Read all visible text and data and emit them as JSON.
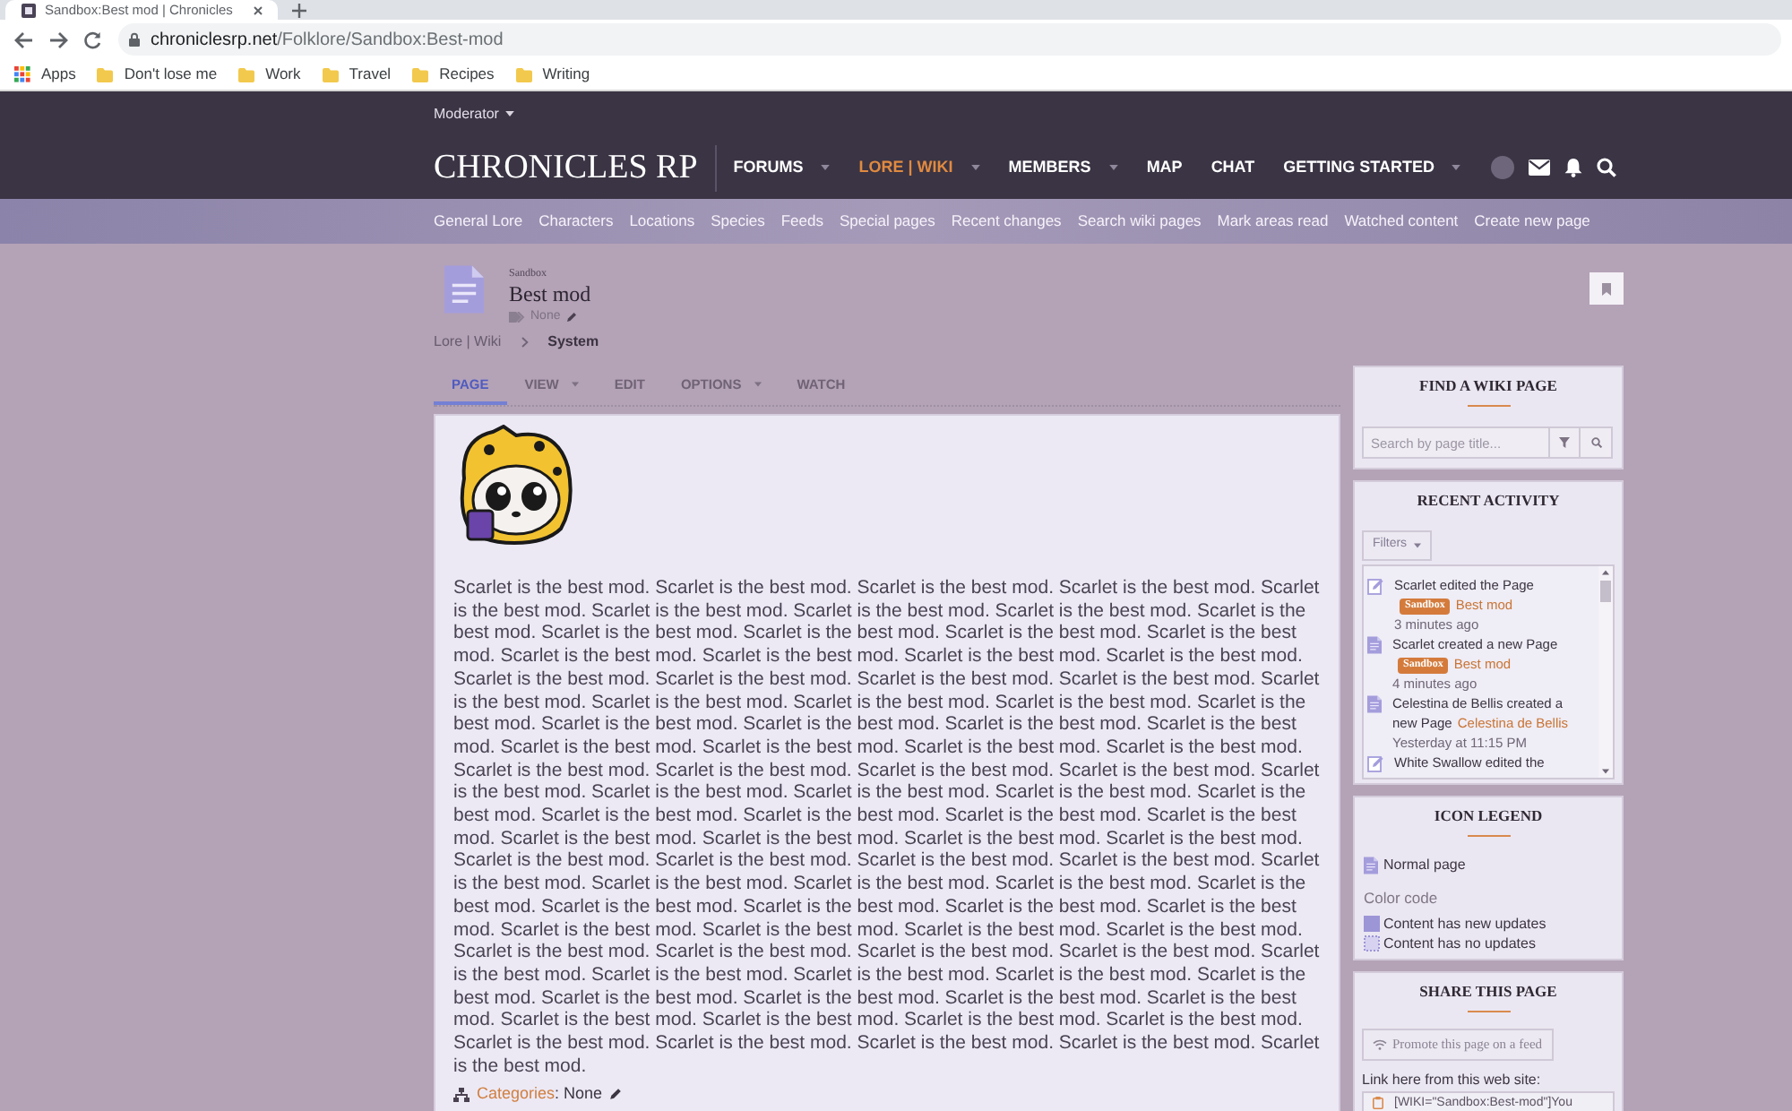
{
  "browser": {
    "tab_title": "Sandbox:Best mod | Chronicles",
    "url_domain": "chroniclesrp.net",
    "url_path": "/Folklore/Sandbox:Best-mod",
    "bookmarks": [
      {
        "kind": "apps",
        "label": "Apps"
      },
      {
        "kind": "folder",
        "label": "Don't lose me"
      },
      {
        "kind": "folder",
        "label": "Work"
      },
      {
        "kind": "folder",
        "label": "Travel"
      },
      {
        "kind": "folder",
        "label": "Recipes"
      },
      {
        "kind": "folder",
        "label": "Writing"
      }
    ]
  },
  "header": {
    "user_menu": {
      "label": "Moderator",
      "has_menu": true
    },
    "logo": "CHRONICLES RP",
    "nav": [
      {
        "label": "FORUMS",
        "selected": false,
        "has_menu": true
      },
      {
        "label": "LORE | WIKI",
        "selected": true,
        "has_menu": true
      },
      {
        "label": "MEMBERS",
        "selected": false,
        "has_menu": true
      },
      {
        "label": "MAP",
        "selected": false,
        "has_menu": false
      },
      {
        "label": "CHAT",
        "selected": false,
        "has_menu": false
      },
      {
        "label": "GETTING STARTED",
        "selected": false,
        "has_menu": true
      }
    ]
  },
  "subnav": [
    "General Lore",
    "Characters",
    "Locations",
    "Species",
    "Feeds",
    "Special pages",
    "Recent changes",
    "Search wiki pages",
    "Mark areas read",
    "Watched content",
    "Create new page"
  ],
  "page": {
    "namespace": "Sandbox",
    "title": "Best mod",
    "tags": "None",
    "breadcrumb": [
      {
        "label": "Lore | Wiki",
        "current": false
      },
      {
        "label": "System",
        "current": true
      }
    ],
    "tabs": [
      {
        "label": "PAGE",
        "selected": true,
        "has_menu": false
      },
      {
        "label": "VIEW",
        "selected": false,
        "has_menu": true
      },
      {
        "label": "EDIT",
        "selected": false,
        "has_menu": false
      },
      {
        "label": "OPTIONS",
        "selected": false,
        "has_menu": true
      },
      {
        "label": "WATCH",
        "selected": false,
        "has_menu": false
      }
    ],
    "body": "Scarlet is the best mod. Scarlet is the best mod. Scarlet is the best mod. Scarlet is the best mod. Scarlet is the best mod. Scarlet is the best mod. Scarlet is the best mod. Scarlet is the best mod. Scarlet is the best mod. Scarlet is the best mod. Scarlet is the best mod. Scarlet is the best mod. Scarlet is the best mod. Scarlet is the best mod. Scarlet is the best mod. Scarlet is the best mod. Scarlet is the best mod. Scarlet is the best mod. Scarlet is the best mod. Scarlet is the best mod. Scarlet is the best mod. Scarlet is the best mod. Scarlet is the best mod. Scarlet is the best mod. Scarlet is the best mod. Scarlet is the best mod. Scarlet is the best mod. Scarlet is the best mod. Scarlet is the best mod. Scarlet is the best mod. Scarlet is the best mod. Scarlet is the best mod. Scarlet is the best mod. Scarlet is the best mod. Scarlet is the best mod. Scarlet is the best mod. Scarlet is the best mod. Scarlet is the best mod. Scarlet is the best mod. Scarlet is the best mod. Scarlet is the best mod. Scarlet is the best mod. Scarlet is the best mod. Scarlet is the best mod. Scarlet is the best mod. Scarlet is the best mod. Scarlet is the best mod. Scarlet is the best mod. Scarlet is the best mod. Scarlet is the best mod. Scarlet is the best mod. Scarlet is the best mod. Scarlet is the best mod. Scarlet is the best mod. Scarlet is the best mod. Scarlet is the best mod. Scarlet is the best mod. Scarlet is the best mod. Scarlet is the best mod. Scarlet is the best mod. Scarlet is the best mod. Scarlet is the best mod. Scarlet is the best mod. Scarlet is the best mod. Scarlet is the best mod. Scarlet is the best mod. Scarlet is the best mod. Scarlet is the best mod. Scarlet is the best mod. Scarlet is the best mod. Scarlet is the best mod. Scarlet is the best mod. Scarlet is the best mod. Scarlet is the best mod. Scarlet is the best mod. Scarlet is the best mod. Scarlet is the best mod. Scarlet is the best mod. Scarlet is the best mod. Scarlet is the best mod. Scarlet is the best mod. Scarlet is the best mod. Scarlet is the best mod. Scarlet is the best mod. Scarlet is the best mod. Scarlet is the best mod. Scarlet is the best mod. Scarlet is the best mod. Scarlet is the best mod. Scarlet is the best mod.",
    "categories": {
      "label": "Categories",
      "value": ": None"
    }
  },
  "sidebar": [
    {
      "kind": "search",
      "title": "FIND A WIKI PAGE",
      "title_rule": true,
      "placeholder": "Search by page title..."
    },
    {
      "kind": "activity",
      "title": "RECENT ACTIVITY",
      "title_rule": false,
      "filter_button": "Filters",
      "items": [
        {
          "kind": "edit",
          "text": "Scarlet edited the Page",
          "badge": "Sandbox",
          "link": "Best mod",
          "time": "3 minutes ago"
        },
        {
          "kind": "create",
          "text": "Scarlet created a new Page",
          "badge": "Sandbox",
          "link": "Best mod",
          "time": "4 minutes ago"
        },
        {
          "kind": "create",
          "text": "Celestina de Bellis created a new Page",
          "link": "Celestina de Bellis",
          "time": "Yesterday at 11:15 PM"
        },
        {
          "kind": "edit",
          "text": "White Swallow edited the"
        }
      ]
    },
    {
      "kind": "legend",
      "title": "ICON LEGEND",
      "title_rule": true,
      "items": [
        {
          "kind": "page",
          "label": "Normal page"
        }
      ],
      "color_code_title": "Color code",
      "color_items": [
        {
          "kind": "new",
          "label": "Content has new updates"
        },
        {
          "kind": "none",
          "label": "Content has no updates"
        }
      ]
    },
    {
      "kind": "share",
      "title": "SHARE THIS PAGE",
      "title_rule": true,
      "promote_button": "Promote this page on a feed",
      "link_label": "Link here from this web site:",
      "link_code": "[WIKI=\"Sandbox:Best-mod\"]You"
    }
  ]
}
